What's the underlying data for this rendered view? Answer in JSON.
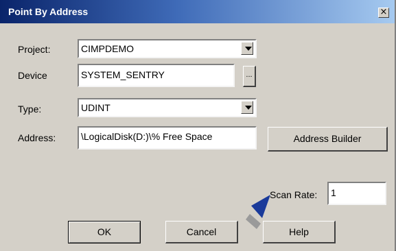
{
  "dialog": {
    "title": "Point By Address",
    "close_glyph": "×"
  },
  "project": {
    "label": "Project:",
    "value": "CIMPDEMO"
  },
  "device": {
    "label": "Device",
    "value": "SYSTEM_SENTRY",
    "browse_label": "..."
  },
  "type": {
    "label": "Type:",
    "value": "UDINT"
  },
  "address": {
    "label": "Address:",
    "value": "\\LogicalDisk(D:)\\% Free Space"
  },
  "address_builder_label": "Address Builder",
  "scan_rate": {
    "label": "Scan Rate:",
    "value": "1"
  },
  "buttons": {
    "ok": "OK",
    "cancel": "Cancel",
    "help": "Help"
  },
  "annotation": {
    "icon": "pointer-arrow-icon",
    "color": "#1a3a9a"
  }
}
